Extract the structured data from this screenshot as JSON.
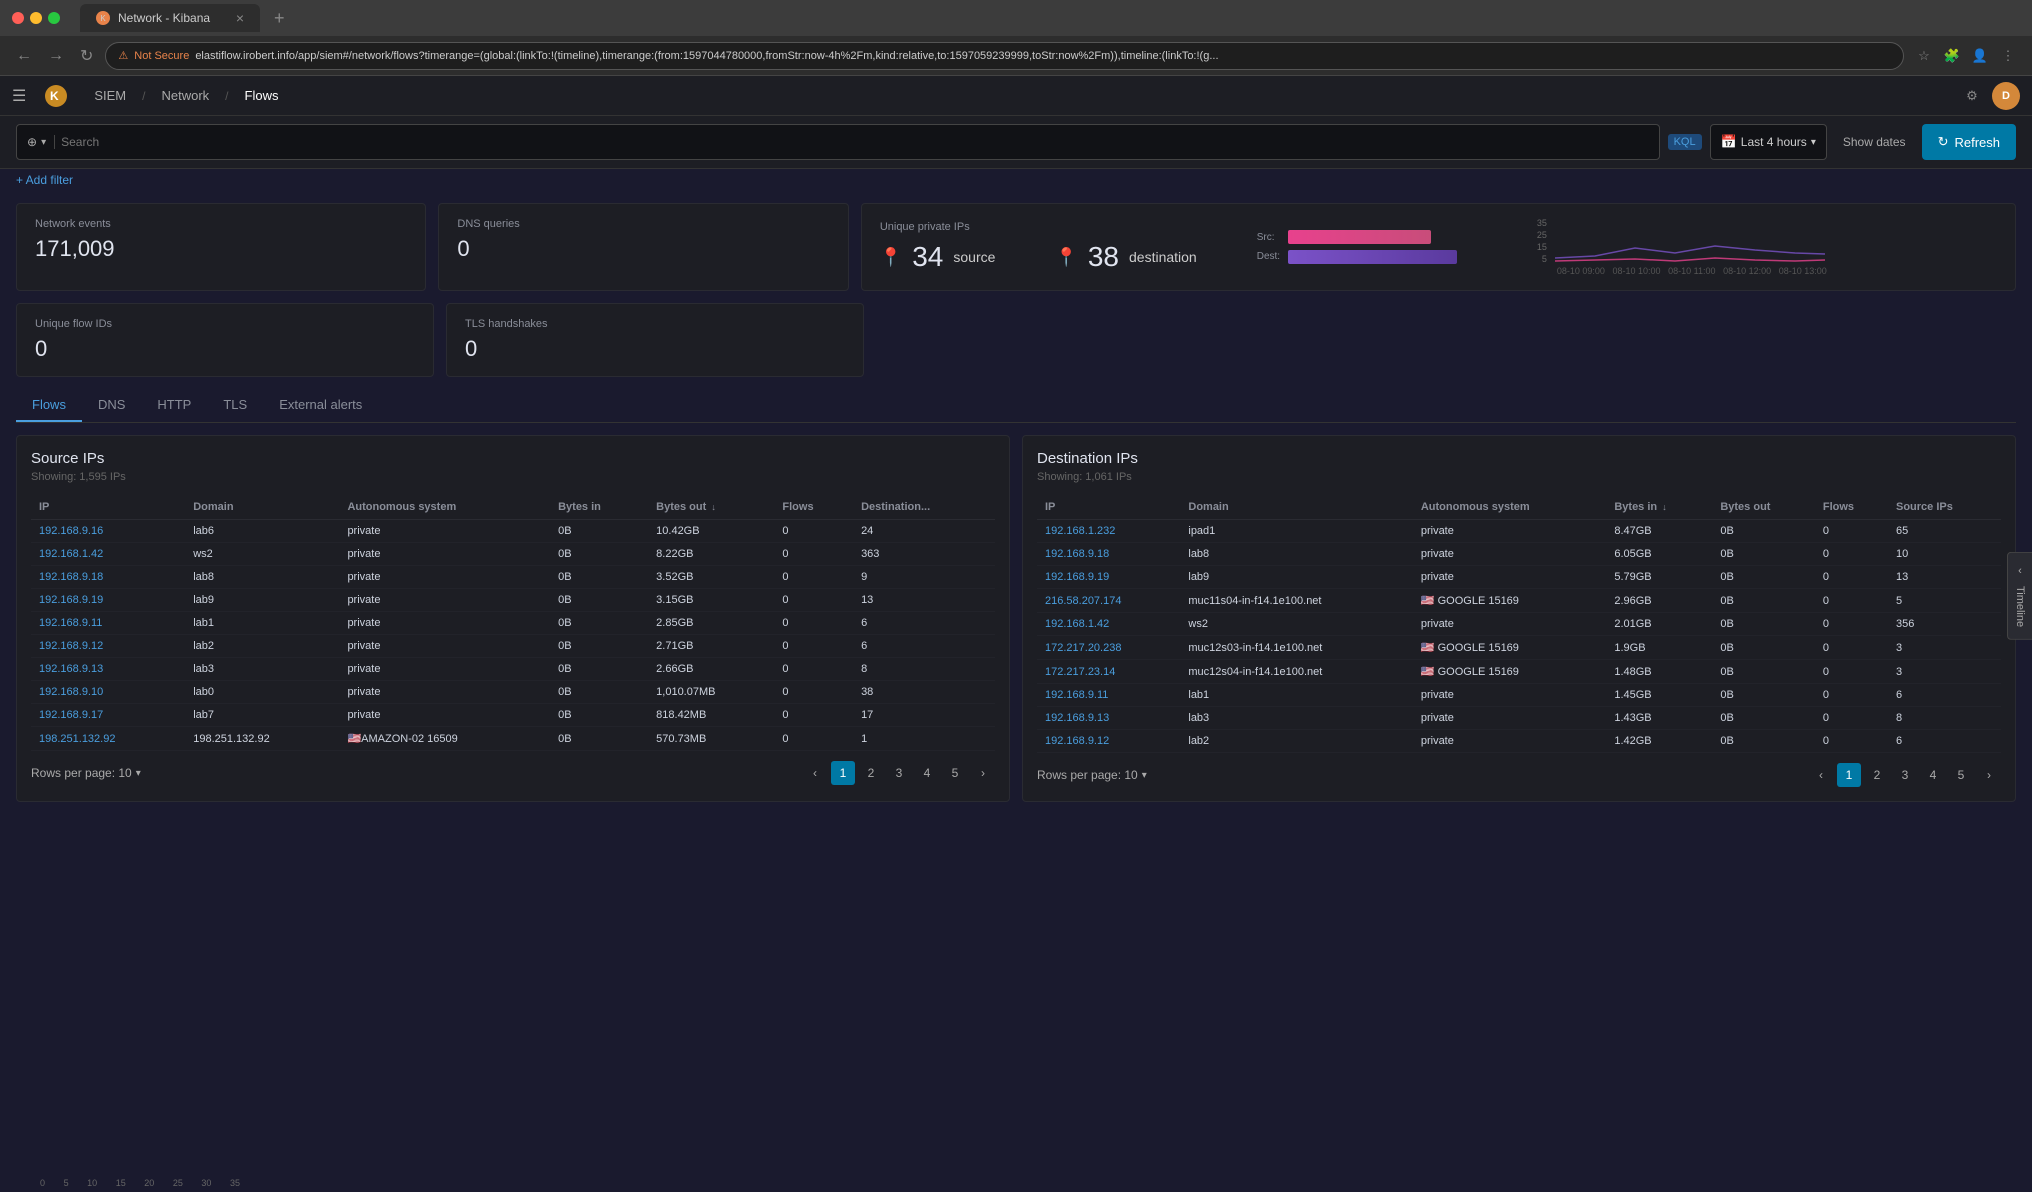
{
  "browser": {
    "tab_title": "Network - Kibana",
    "tab_icon": "K",
    "not_secure": "Not Secure",
    "url": "elastiflow.irobert.info/app/siem#/network/flows?timerange=(global:(linkTo:!(timeline),timerange:(from:1597044780000,fromStr:now-4h%2Fm,kind:relative,to:1597059239999,toStr:now%2Fm)),timeline:(linkTo:!(g...",
    "nav_back": "←",
    "nav_forward": "→",
    "nav_refresh": "↻"
  },
  "app": {
    "nav": {
      "siem": "SIEM",
      "network": "Network",
      "flows": "Flows"
    },
    "user_initial": "D"
  },
  "filter_bar": {
    "search_placeholder": "Search",
    "kql_label": "KQL",
    "time_range": "Last 4 hours",
    "show_dates": "Show dates",
    "refresh": "Refresh",
    "add_filter": "+ Add filter"
  },
  "stats": {
    "network_events_label": "Network events",
    "network_events_value": "171,009",
    "dns_queries_label": "DNS queries",
    "dns_queries_value": "0",
    "unique_flow_ids_label": "Unique flow IDs",
    "unique_flow_ids_value": "0",
    "tls_handshakes_label": "TLS handshakes",
    "tls_handshakes_value": "0",
    "unique_private_ips_label": "Unique private IPs",
    "source_count": "34",
    "source_label": "source",
    "destination_count": "38",
    "destination_label": "destination",
    "src_chart_label": "Src:",
    "dst_chart_label": "Dest:",
    "bar_src_width": "72%",
    "bar_dst_width": "85%"
  },
  "timeline_chart": {
    "y_labels": [
      "35",
      "25",
      "15",
      "5"
    ],
    "x_labels": [
      "08-10 09:00",
      "08-10 10:00",
      "08-10 11:00",
      "08-10 12:00",
      "08-10 13:00"
    ]
  },
  "tabs": [
    {
      "label": "Flows",
      "active": true
    },
    {
      "label": "DNS",
      "active": false
    },
    {
      "label": "HTTP",
      "active": false
    },
    {
      "label": "TLS",
      "active": false
    },
    {
      "label": "External alerts",
      "active": false
    }
  ],
  "source_ips": {
    "title": "Source IPs",
    "subtitle": "Showing: 1,595 IPs",
    "columns": [
      "IP",
      "Domain",
      "Autonomous system",
      "Bytes in",
      "Bytes out ↓",
      "Flows",
      "Destination..."
    ],
    "rows": [
      {
        "ip": "192.168.9.16",
        "domain": "lab6",
        "as": "private",
        "bytes_in": "0B",
        "bytes_out": "10.42GB",
        "flows": "0",
        "dest": "24"
      },
      {
        "ip": "192.168.1.42",
        "domain": "ws2",
        "as": "private",
        "bytes_in": "0B",
        "bytes_out": "8.22GB",
        "flows": "0",
        "dest": "363"
      },
      {
        "ip": "192.168.9.18",
        "domain": "lab8",
        "as": "private",
        "bytes_in": "0B",
        "bytes_out": "3.52GB",
        "flows": "0",
        "dest": "9"
      },
      {
        "ip": "192.168.9.19",
        "domain": "lab9",
        "as": "private",
        "bytes_in": "0B",
        "bytes_out": "3.15GB",
        "flows": "0",
        "dest": "13"
      },
      {
        "ip": "192.168.9.11",
        "domain": "lab1",
        "as": "private",
        "bytes_in": "0B",
        "bytes_out": "2.85GB",
        "flows": "0",
        "dest": "6"
      },
      {
        "ip": "192.168.9.12",
        "domain": "lab2",
        "as": "private",
        "bytes_in": "0B",
        "bytes_out": "2.71GB",
        "flows": "0",
        "dest": "6"
      },
      {
        "ip": "192.168.9.13",
        "domain": "lab3",
        "as": "private",
        "bytes_in": "0B",
        "bytes_out": "2.66GB",
        "flows": "0",
        "dest": "8"
      },
      {
        "ip": "192.168.9.10",
        "domain": "lab0",
        "as": "private",
        "bytes_in": "0B",
        "bytes_out": "1,010.07MB",
        "flows": "0",
        "dest": "38"
      },
      {
        "ip": "192.168.9.17",
        "domain": "lab7",
        "as": "private",
        "bytes_in": "0B",
        "bytes_out": "818.42MB",
        "flows": "0",
        "dest": "17"
      },
      {
        "ip": "198.251.132.92",
        "domain": "198.251.132.92",
        "as": "AMAZON-02\n16509",
        "bytes_in": "0B",
        "bytes_out": "570.73MB",
        "flows": "0",
        "dest": "1",
        "flag": "🇺🇸"
      }
    ],
    "rows_per_page": "Rows per page: 10",
    "pages": [
      "1",
      "2",
      "3",
      "4",
      "5"
    ]
  },
  "destination_ips": {
    "title": "Destination IPs",
    "subtitle": "Showing: 1,061 IPs",
    "columns": [
      "IP",
      "Domain",
      "Autonomous system",
      "Bytes in ↓",
      "Bytes out",
      "Flows",
      "Source IPs"
    ],
    "rows": [
      {
        "ip": "192.168.1.232",
        "domain": "ipad1",
        "as": "private",
        "bytes_in": "8.47GB",
        "bytes_out": "0B",
        "flows": "0",
        "src": "65"
      },
      {
        "ip": "192.168.9.18",
        "domain": "lab8",
        "as": "private",
        "bytes_in": "6.05GB",
        "bytes_out": "0B",
        "flows": "0",
        "src": "10"
      },
      {
        "ip": "192.168.9.19",
        "domain": "lab9",
        "as": "private",
        "bytes_in": "5.79GB",
        "bytes_out": "0B",
        "flows": "0",
        "src": "13"
      },
      {
        "ip": "216.58.207.174",
        "domain": "muc11s04-in-f14.1e100.net",
        "as": "GOOGLE\n15169",
        "bytes_in": "2.96GB",
        "bytes_out": "0B",
        "flows": "0",
        "src": "5",
        "flag": "🇺🇸"
      },
      {
        "ip": "192.168.1.42",
        "domain": "ws2",
        "as": "private",
        "bytes_in": "2.01GB",
        "bytes_out": "0B",
        "flows": "0",
        "src": "356"
      },
      {
        "ip": "172.217.20.238",
        "domain": "muc12s03-in-f14.1e100.net",
        "as": "GOOGLE\n15169",
        "bytes_in": "1.9GB",
        "bytes_out": "0B",
        "flows": "0",
        "src": "3",
        "flag": "🇺🇸"
      },
      {
        "ip": "172.217.23.14",
        "domain": "muc12s04-in-f14.1e100.net",
        "as": "GOOGLE\n15169",
        "bytes_in": "1.48GB",
        "bytes_out": "0B",
        "flows": "0",
        "src": "3",
        "flag": "🇺🇸"
      },
      {
        "ip": "192.168.9.11",
        "domain": "lab1",
        "as": "private",
        "bytes_in": "1.45GB",
        "bytes_out": "0B",
        "flows": "0",
        "src": "6"
      },
      {
        "ip": "192.168.9.13",
        "domain": "lab3",
        "as": "private",
        "bytes_in": "1.43GB",
        "bytes_out": "0B",
        "flows": "0",
        "src": "8"
      },
      {
        "ip": "192.168.9.12",
        "domain": "lab2",
        "as": "private",
        "bytes_in": "1.42GB",
        "bytes_out": "0B",
        "flows": "0",
        "src": "6"
      }
    ],
    "rows_per_page": "Rows per page: 10",
    "pages": [
      "1",
      "2",
      "3",
      "4",
      "5"
    ]
  },
  "timeline_sidebar": {
    "label": "Timeline"
  }
}
